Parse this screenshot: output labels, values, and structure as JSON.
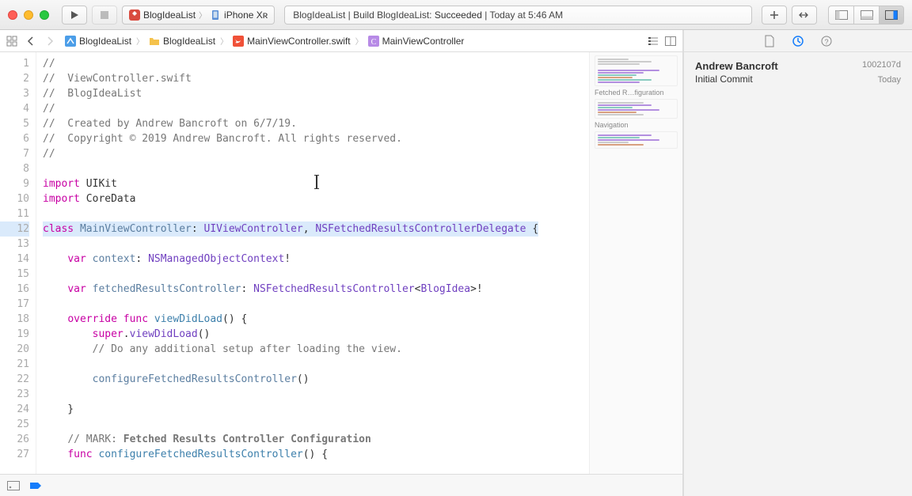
{
  "toolbar": {
    "scheme_left": "BlogIdeaList",
    "scheme_right": "iPhone Xʀ",
    "status_prefix": "BlogIdeaList | Build BlogIdeaList: ",
    "status_result": "Succeeded",
    "status_suffix": " | Today at 5:46 AM"
  },
  "jumpbar": {
    "items": [
      "BlogIdeaList",
      "BlogIdeaList",
      "MainViewController.swift",
      "MainViewController"
    ]
  },
  "code": {
    "lines": [
      {
        "n": 1,
        "segs": [
          {
            "t": "//",
            "c": "com"
          }
        ]
      },
      {
        "n": 2,
        "segs": [
          {
            "t": "//  ViewController.swift",
            "c": "com"
          }
        ]
      },
      {
        "n": 3,
        "segs": [
          {
            "t": "//  BlogIdeaList",
            "c": "com"
          }
        ]
      },
      {
        "n": 4,
        "segs": [
          {
            "t": "//",
            "c": "com"
          }
        ]
      },
      {
        "n": 5,
        "segs": [
          {
            "t": "//  Created by Andrew Bancroft on 6/7/19.",
            "c": "com"
          }
        ]
      },
      {
        "n": 6,
        "segs": [
          {
            "t": "//  Copyright © 2019 Andrew Bancroft. All rights reserved.",
            "c": "com"
          }
        ]
      },
      {
        "n": 7,
        "segs": [
          {
            "t": "//",
            "c": "com"
          }
        ]
      },
      {
        "n": 8,
        "segs": [
          {
            "t": "",
            "c": ""
          }
        ]
      },
      {
        "n": 9,
        "segs": [
          {
            "t": "import",
            "c": "kw"
          },
          {
            "t": " UIKit",
            "c": ""
          }
        ]
      },
      {
        "n": 10,
        "segs": [
          {
            "t": "import",
            "c": "kw"
          },
          {
            "t": " CoreData",
            "c": ""
          }
        ]
      },
      {
        "n": 11,
        "segs": [
          {
            "t": "",
            "c": ""
          }
        ]
      },
      {
        "n": 12,
        "hl": true,
        "segs": [
          {
            "t": "class",
            "c": "kw"
          },
          {
            "t": " ",
            "c": ""
          },
          {
            "t": "MainViewController",
            "c": "nm"
          },
          {
            "t": ": ",
            "c": ""
          },
          {
            "t": "UIViewController",
            "c": "typ"
          },
          {
            "t": ", ",
            "c": ""
          },
          {
            "t": "NSFetchedResultsControllerDelegate",
            "c": "typ"
          },
          {
            "t": " {",
            "c": ""
          }
        ]
      },
      {
        "n": 13,
        "segs": [
          {
            "t": "",
            "c": ""
          }
        ]
      },
      {
        "n": 14,
        "segs": [
          {
            "t": "    ",
            "c": ""
          },
          {
            "t": "var",
            "c": "kw"
          },
          {
            "t": " ",
            "c": ""
          },
          {
            "t": "context",
            "c": "nm"
          },
          {
            "t": ": ",
            "c": ""
          },
          {
            "t": "NSManagedObjectContext",
            "c": "typ"
          },
          {
            "t": "!",
            "c": ""
          }
        ]
      },
      {
        "n": 15,
        "segs": [
          {
            "t": "",
            "c": ""
          }
        ]
      },
      {
        "n": 16,
        "segs": [
          {
            "t": "    ",
            "c": ""
          },
          {
            "t": "var",
            "c": "kw"
          },
          {
            "t": " ",
            "c": ""
          },
          {
            "t": "fetchedResultsController",
            "c": "nm"
          },
          {
            "t": ": ",
            "c": ""
          },
          {
            "t": "NSFetchedResultsController",
            "c": "typ"
          },
          {
            "t": "<",
            "c": ""
          },
          {
            "t": "BlogIdea",
            "c": "typ"
          },
          {
            "t": ">!",
            "c": ""
          }
        ]
      },
      {
        "n": 17,
        "segs": [
          {
            "t": "",
            "c": ""
          }
        ]
      },
      {
        "n": 18,
        "segs": [
          {
            "t": "    ",
            "c": ""
          },
          {
            "t": "override",
            "c": "kw"
          },
          {
            "t": " ",
            "c": ""
          },
          {
            "t": "func",
            "c": "kw"
          },
          {
            "t": " ",
            "c": ""
          },
          {
            "t": "viewDidLoad",
            "c": "fn"
          },
          {
            "t": "() {",
            "c": ""
          }
        ]
      },
      {
        "n": 19,
        "segs": [
          {
            "t": "        ",
            "c": ""
          },
          {
            "t": "super",
            "c": "kw"
          },
          {
            "t": ".",
            "c": ""
          },
          {
            "t": "viewDidLoad",
            "c": "typ"
          },
          {
            "t": "()",
            "c": ""
          }
        ]
      },
      {
        "n": 20,
        "segs": [
          {
            "t": "        ",
            "c": ""
          },
          {
            "t": "// Do any additional setup after loading the view.",
            "c": "com"
          }
        ]
      },
      {
        "n": 21,
        "segs": [
          {
            "t": "",
            "c": ""
          }
        ]
      },
      {
        "n": 22,
        "segs": [
          {
            "t": "        ",
            "c": ""
          },
          {
            "t": "configureFetchedResultsController",
            "c": "nm"
          },
          {
            "t": "()",
            "c": ""
          }
        ]
      },
      {
        "n": 23,
        "segs": [
          {
            "t": "",
            "c": ""
          }
        ]
      },
      {
        "n": 24,
        "segs": [
          {
            "t": "    }",
            "c": ""
          }
        ]
      },
      {
        "n": 25,
        "segs": [
          {
            "t": "",
            "c": ""
          }
        ]
      },
      {
        "n": 26,
        "segs": [
          {
            "t": "    ",
            "c": ""
          },
          {
            "t": "// MARK: ",
            "c": "com"
          },
          {
            "t": "Fetched Results Controller Configuration",
            "c": "com b"
          }
        ]
      },
      {
        "n": 27,
        "segs": [
          {
            "t": "    ",
            "c": ""
          },
          {
            "t": "func",
            "c": "kw"
          },
          {
            "t": " ",
            "c": ""
          },
          {
            "t": "configureFetchedResultsController",
            "c": "fn"
          },
          {
            "t": "() {",
            "c": ""
          }
        ]
      }
    ]
  },
  "minimap": {
    "section1": "Fetched R…figuration",
    "section2": "Navigation"
  },
  "inspector": {
    "commit_name": "Andrew Bancroft",
    "commit_hash": "1002107d",
    "commit_msg": "Initial Commit",
    "commit_date": "Today"
  }
}
